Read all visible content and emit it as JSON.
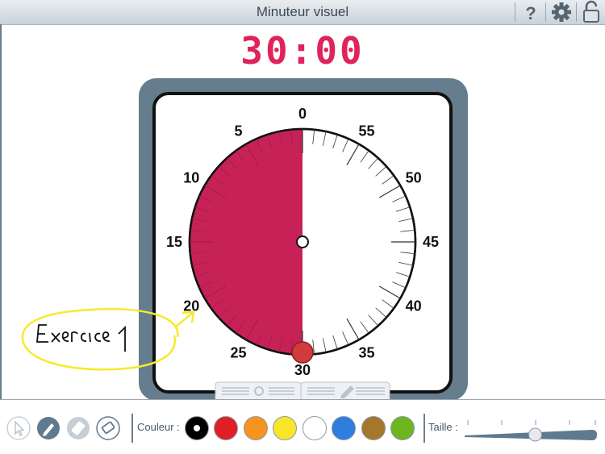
{
  "header": {
    "title": "Minuteur visuel",
    "icons": [
      "help-icon",
      "gear-icon",
      "lock-icon"
    ]
  },
  "timer": {
    "display": "30:00",
    "remaining_minutes": 30,
    "max_minutes": 60,
    "dial_labels": [
      "0",
      "5",
      "10",
      "15",
      "20",
      "25",
      "30",
      "35",
      "40",
      "45",
      "50",
      "55"
    ],
    "fill_color": "#c62257",
    "digital_color": "#e1235c",
    "frame_color": "#657d8c"
  },
  "annotation": {
    "handwritten_text": "Exercice 1",
    "ink_color": "#f5ea2e"
  },
  "toolbar": {
    "tools": [
      "select-tool",
      "pen-tool",
      "highlighter-tool",
      "eraser-tool"
    ],
    "color_label": "Couleur :",
    "colors": [
      "#000000",
      "#e01e26",
      "#f7931e",
      "#f9e52a",
      "#ffffff",
      "#2f7ddf",
      "#a4772a",
      "#6db620"
    ],
    "selected_color": "#000000",
    "size_label": "Taille :",
    "size_level": 0.62
  }
}
